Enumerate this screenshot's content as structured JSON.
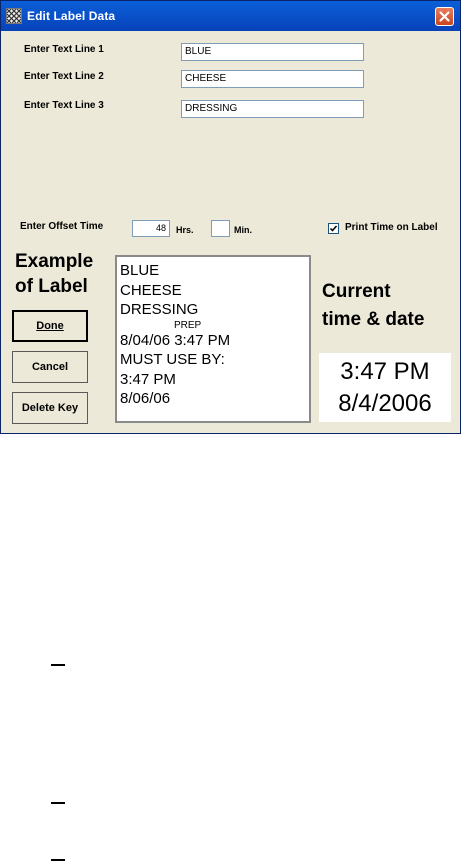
{
  "window": {
    "title": "Edit Label Data",
    "close_icon": "close-icon",
    "app_icon": "label-app-icon"
  },
  "text_lines": [
    {
      "label": "Enter Text Line 1",
      "value": "BLUE"
    },
    {
      "label": "Enter Text Line 2",
      "value": "CHEESE"
    },
    {
      "label": "Enter Text Line 3",
      "value": "DRESSING"
    }
  ],
  "offset": {
    "label": "Enter Offset Time",
    "hours_value": "48",
    "hours_unit": "Hrs.",
    "minutes_value": "",
    "minutes_unit": "Min."
  },
  "print_time": {
    "checked": true,
    "label": "Print Time on Label"
  },
  "example": {
    "title_line1": "Example",
    "title_line2": "of Label",
    "lines": [
      "BLUE",
      "CHEESE",
      "DRESSING"
    ],
    "prep_label": "PREP",
    "prep_time": "8/04/06 3:47 PM",
    "use_by_label": "MUST USE BY:",
    "use_by_time": "3:47 PM",
    "use_by_date": "8/06/06"
  },
  "buttons": {
    "done": "Done",
    "cancel": "Cancel",
    "delete_key": "Delete Key"
  },
  "current": {
    "title_line1": "Current",
    "title_line2": "time & date",
    "time": "3:47 PM",
    "date": "8/4/2006"
  },
  "colors": {
    "titlebar": "#0842b9",
    "dialog_bg": "#ece9d8",
    "close_button": "#c8451f"
  }
}
